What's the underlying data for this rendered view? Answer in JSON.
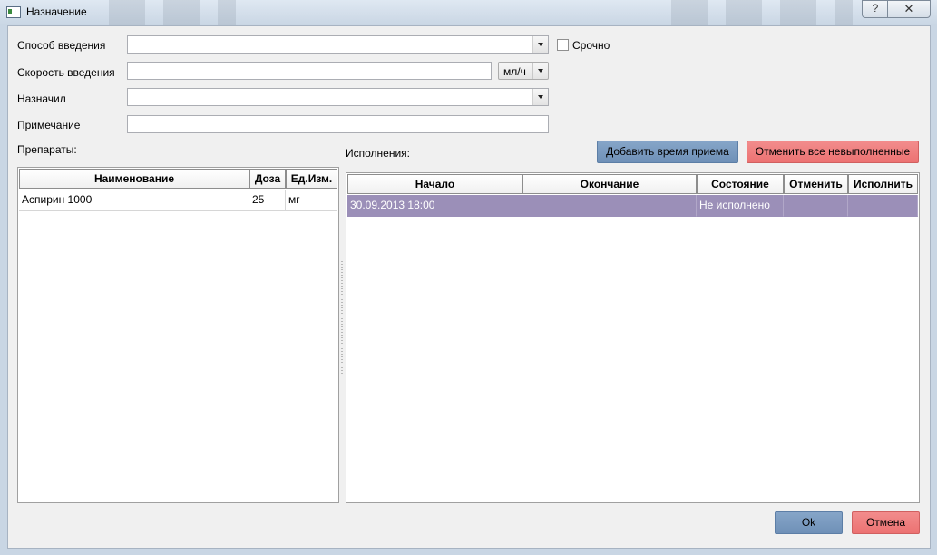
{
  "window": {
    "title": "Назначение",
    "help_glyph": "?",
    "close_glyph": "✕"
  },
  "form": {
    "route_label": "Способ введения",
    "route_value": "",
    "urgent_label": "Срочно",
    "urgent_checked": false,
    "speed_label": "Скорость введения",
    "speed_value": "",
    "speed_unit": "мл/ч",
    "prescribed_label": "Назначил",
    "prescribed_value": "",
    "note_label": "Примечание",
    "note_value": ""
  },
  "drugs": {
    "label": "Препараты:",
    "columns": [
      "Наименование",
      "Доза",
      "Ед.Изм."
    ],
    "rows": [
      [
        "Аспирин 1000",
        "25",
        "мг"
      ]
    ]
  },
  "executions": {
    "label": "Исполнения:",
    "add_button": "Добавить время приема",
    "cancel_all_button": "Отменить все невыполненные",
    "columns": [
      "Начало",
      "Окончание",
      "Состояние",
      "Отменить",
      "Исполнить"
    ],
    "rows": [
      [
        "30.09.2013 18:00",
        "",
        "Не исполнено",
        "",
        ""
      ]
    ],
    "selected_row_color": "#9b8fb8"
  },
  "footer": {
    "ok_label": "Ok",
    "cancel_label": "Отмена"
  },
  "colors": {
    "blue_button": "#7596bd",
    "red_button": "#ef7f7f"
  }
}
